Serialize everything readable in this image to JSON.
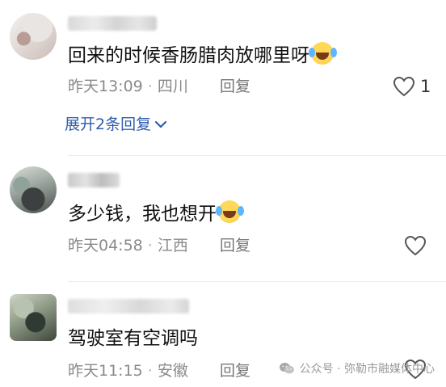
{
  "comments": [
    {
      "text": "回来的时候香肠腊肉放哪里呀",
      "emoji": "laughing-crying-emoji",
      "time": "昨天13:09",
      "location": "四川",
      "reply_label": "回复",
      "likes": "1",
      "expand_label": "展开2条回复"
    },
    {
      "username": "明贝黄",
      "text": "多少钱，我也想开",
      "emoji": "laughing-crying-emoji",
      "time": "昨天04:58",
      "location": "江西",
      "reply_label": "回复"
    },
    {
      "text": "驾驶室有空调吗",
      "time": "昨天11:15",
      "location": "安徽",
      "reply_label": "回复"
    }
  ],
  "watermark": {
    "text": "公众号 · 弥勒市融媒体中心",
    "icon": "wechat-icon"
  },
  "colors": {
    "link": "#2f5dae",
    "meta": "#8a8a8a",
    "text": "#111111"
  }
}
